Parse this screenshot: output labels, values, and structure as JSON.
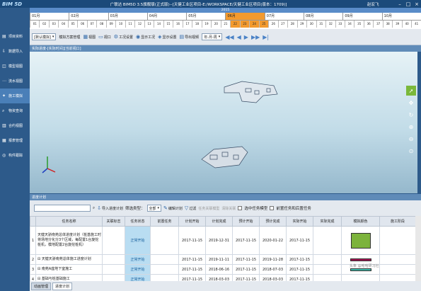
{
  "app": {
    "logo": "BIM 5D",
    "title": "广联达 BIM5D 3.5旗舰版(正式版)--[天健工业区项目-E:/WORKSPACE/天健工业区项目(版本：1709)]",
    "user": "赵宏飞"
  },
  "timeline": {
    "year": "2015",
    "months": [
      "01月",
      "02月",
      "03月",
      "04月",
      "05月",
      "06月",
      "07月",
      "08月",
      "09月",
      "10月"
    ],
    "weeks": [
      "01",
      "02",
      "03",
      "04",
      "05",
      "06",
      "07",
      "08",
      "09",
      "10",
      "11",
      "12",
      "13",
      "14",
      "15",
      "16",
      "17",
      "18",
      "19",
      "20",
      "21",
      "22",
      "23",
      "24",
      "25",
      "26",
      "27",
      "28",
      "29",
      "30",
      "31",
      "32",
      "33",
      "34",
      "35",
      "36",
      "37",
      "38",
      "39",
      "40",
      "41"
    ]
  },
  "sidebar": {
    "items": [
      {
        "label": "项目资料",
        "icon": "document-icon"
      },
      {
        "label": "数据导入",
        "icon": "import-icon"
      },
      {
        "label": "模型视图",
        "icon": "cube-icon"
      },
      {
        "label": "流水视图",
        "icon": "flow-icon"
      },
      {
        "label": "施工模拟",
        "icon": "simulation-icon"
      },
      {
        "label": "物资查询",
        "icon": "query-icon"
      },
      {
        "label": "合约视图",
        "icon": "contract-icon"
      },
      {
        "label": "报表管理",
        "icon": "report-icon"
      },
      {
        "label": "构件跟踪",
        "icon": "tracking-icon"
      }
    ]
  },
  "toolbar": {
    "mode": "[默认模拟]",
    "scheme": "模拟方案管理",
    "view": "视图",
    "window": "视口",
    "work": "工况设置",
    "show_work": "显示工况",
    "show_settings": "显示设置",
    "export": "导出视频",
    "date_fmt": "年-月-周"
  },
  "viewport": {
    "title": "实际进度-[实际时间][当前视口]"
  },
  "schedule": {
    "title": "进度计划",
    "import_label": "导入进度计划",
    "filter_label": "筛选类型：",
    "filter_value": "全部",
    "edit_label": "编辑计划",
    "filter_btn": "过滤",
    "assoc": "任务关联模型",
    "unlink": "清除关联",
    "check1": "选中任务模型",
    "check2": "前置任务和后置任务",
    "columns": [
      "",
      "任务名称",
      "关联标志",
      "任务状态",
      "前置任务",
      "计划开始",
      "计划完成",
      "预计开始",
      "预计完成",
      "实际开始",
      "实际完成",
      "模拟颜色",
      "施工阶段"
    ],
    "rows": [
      {
        "n": "1",
        "name": "天健天骄南苑总体进度计划（桩基施工时将场地分化分3个区域，每配置1台旋挖桩机，模地配置2台旋挖桩机）",
        "flag": "",
        "status": "正常开始",
        "pre": "",
        "ps": "2017-11-15",
        "pe": "2019-12-31",
        "es": "2017-11-15",
        "ee": "2020-01-22",
        "as": "2017-11-15",
        "ae": "",
        "color": "green"
      },
      {
        "n": "2",
        "name": "⊟ 天健天骄南苑总体施工进度计划",
        "flag": "",
        "status": "正常开始",
        "pre": "",
        "ps": "2017-11-15",
        "pe": "2019-11-11",
        "es": "2017-11-15",
        "ee": "2019-11-28",
        "as": "2017-11-15",
        "ae": "",
        "color": "magenta"
      },
      {
        "n": "3",
        "name": "⊟ 南苑A座地下室施工",
        "flag": "",
        "status": "正常开始",
        "pre": "",
        "ps": "2017-11-15",
        "pe": "2018-06-16",
        "es": "2017-11-15",
        "ee": "2018-07-03",
        "as": "2017-11-15",
        "ae": "",
        "color": "teal"
      },
      {
        "n": "4",
        "name": "⊟ 基础与桩基础施工",
        "flag": "",
        "status": "正常开始",
        "pre": "",
        "ps": "2017-11-15",
        "pe": "2018-03-03",
        "es": "2017-11-15",
        "ee": "2018-03-03",
        "as": "2017-11-15",
        "ae": "",
        "color": ""
      }
    ]
  },
  "bottom": {
    "tabs": [
      "动画管理",
      "进度计划"
    ]
  },
  "watermark": "头条 @哈哈研习社",
  "colors": {
    "accent": "#f39a2e",
    "nav": "#1b4a7a",
    "panel": "#5f8bb8",
    "green": "#7cb33c"
  }
}
